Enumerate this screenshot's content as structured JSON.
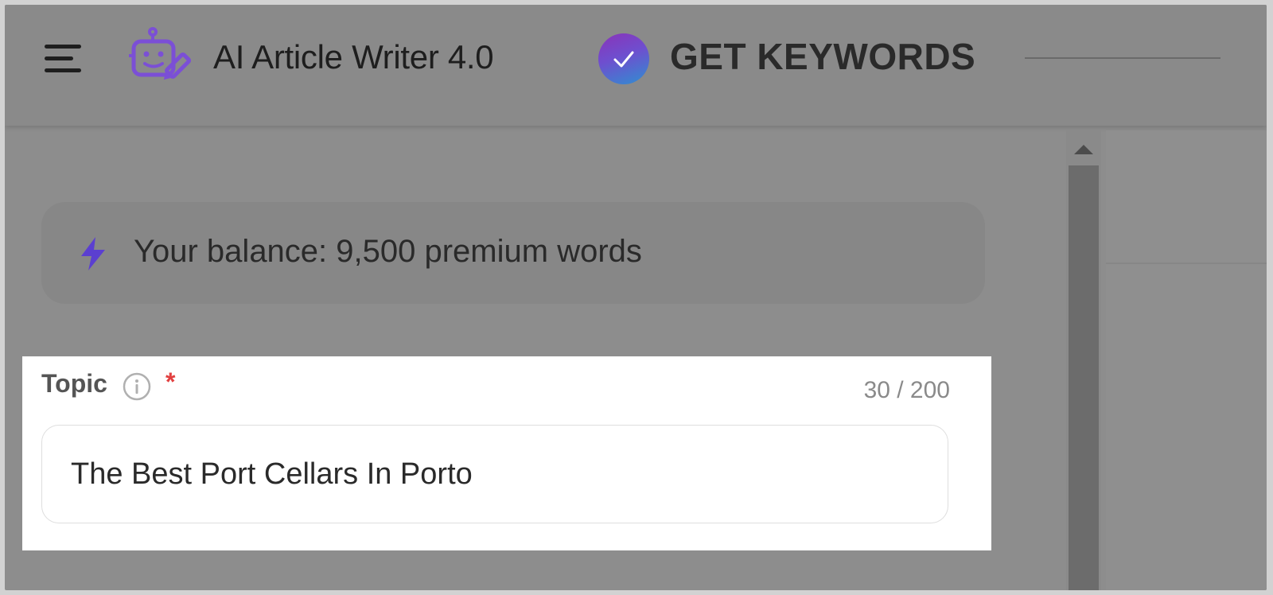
{
  "header": {
    "app_title": "AI Article Writer 4.0",
    "keywords_label": "GET KEYWORDS",
    "icons": {
      "menu": "hamburger-menu-icon",
      "app": "robot-pencil-icon",
      "badge": "check-circle-icon"
    }
  },
  "balance": {
    "text": "Your balance: 9,500 premium words",
    "icon": "lightning-bolt-icon"
  },
  "topic_field": {
    "label": "Topic",
    "required_marker": "*",
    "char_count": "30 / 200",
    "value": "The Best Port Cellars In Porto",
    "icon": "info-circle-icon"
  },
  "colors": {
    "accent_purple": "#7b4fd6",
    "required_red": "#e24040",
    "badge_gradient_start": "#8a33b8",
    "badge_gradient_end": "#2f8fd0"
  }
}
